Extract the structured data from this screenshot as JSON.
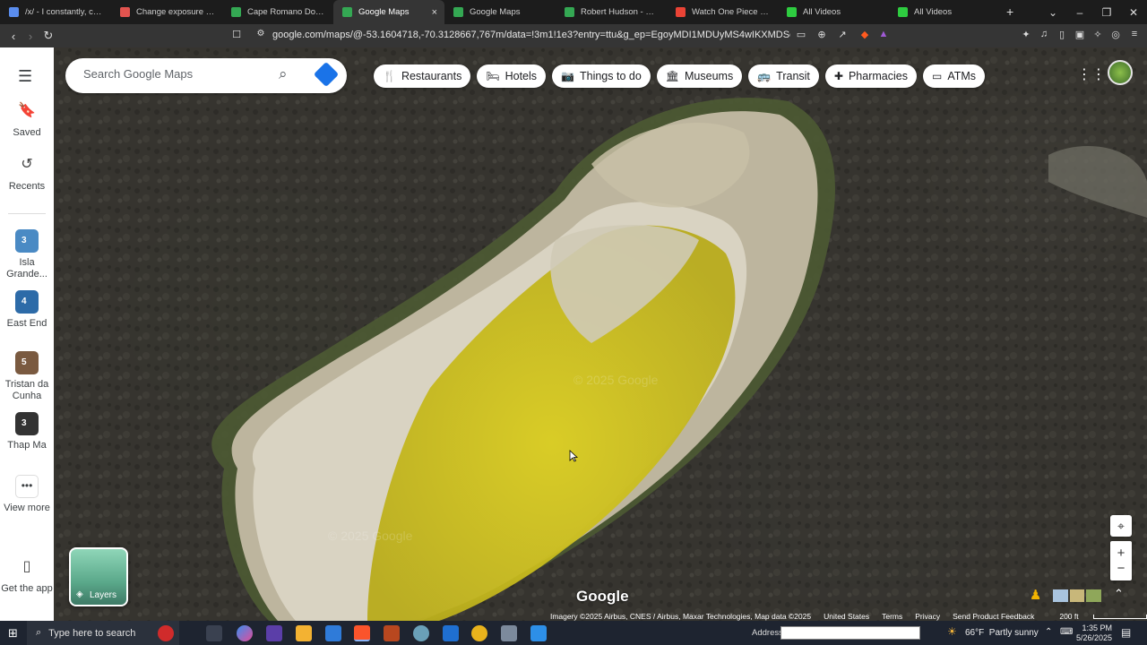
{
  "browser": {
    "tabs": [
      {
        "title": "/x/ - I constantly, constant",
        "favicon": "grid-icon",
        "color": "#5a8dee"
      },
      {
        "title": "Change exposure online",
        "favicon": "image-edit-icon",
        "color": "#e2544f"
      },
      {
        "title": "Cape Romano Dome Hou",
        "favicon": "maps-pin-icon",
        "color": "#34a853"
      },
      {
        "title": "Google Maps",
        "favicon": "maps-pin-icon",
        "color": "#34a853",
        "active": true
      },
      {
        "title": "Google Maps",
        "favicon": "maps-pin-icon",
        "color": "#34a853"
      },
      {
        "title": "Robert Hudson - Google",
        "favicon": "maps-pin-icon",
        "color": "#34a853"
      },
      {
        "title": "Watch One Piece Episode",
        "favicon": "play-icon",
        "color": "#ea4335"
      },
      {
        "title": "All Videos",
        "favicon": "play-icon",
        "color": "#2ecc40"
      },
      {
        "title": "All Videos",
        "favicon": "play-icon",
        "color": "#2ecc40"
      }
    ],
    "url": "google.com/maps/@-53.1604718,-70.3128667,767m/data=!3m1!1e3?entry=ttu&g_ep=EgoyMDI1MDUyMS4wIKXMDSoASAFQAw%3D%3D"
  },
  "rail": {
    "menu_icon": "menu-icon",
    "items": [
      {
        "label": "Saved",
        "icon": "bookmark-icon"
      },
      {
        "label": "Recents",
        "icon": "history-icon"
      }
    ],
    "recents": [
      {
        "label": "Isla Grande...",
        "badge": "3",
        "color": "#4a8ac4"
      },
      {
        "label": "East End",
        "badge": "4",
        "color": "#2d6ba8"
      },
      {
        "label": "Tristan da Cunha",
        "badge": "5",
        "color": "#7a5a40"
      },
      {
        "label": "Thap Ma",
        "badge": "3",
        "color": "#333333"
      }
    ],
    "view_more": "View more",
    "get_app": "Get the app",
    "layers": "Layers"
  },
  "search": {
    "placeholder": "Search Google Maps"
  },
  "chips": [
    {
      "label": "Restaurants",
      "icon": "fork-knife-icon"
    },
    {
      "label": "Hotels",
      "icon": "bed-icon"
    },
    {
      "label": "Things to do",
      "icon": "camera-icon"
    },
    {
      "label": "Museums",
      "icon": "museum-icon"
    },
    {
      "label": "Transit",
      "icon": "bus-icon"
    },
    {
      "label": "Pharmacies",
      "icon": "pharmacy-icon"
    },
    {
      "label": "ATMs",
      "icon": "atm-icon"
    }
  ],
  "map": {
    "logo": "Google",
    "watermark": "© 2025 Google",
    "attribution": "Imagery ©2025 Airbus, CNES / Airbus, Maxar Technologies, Map data ©2025",
    "country": "United States",
    "terms": "Terms",
    "privacy": "Privacy",
    "feedback": "Send Product Feedback",
    "scale": "200 ft",
    "lake_colors": {
      "salt": "#d9d3c2",
      "algae": "#d9cc1e",
      "shore": "#bdb59e"
    }
  },
  "taskbar": {
    "search_placeholder": "Type here to search",
    "address_label": "Address",
    "weather": "66°F  Partly sunny",
    "time": "1:35 PM",
    "date": "5/26/2025"
  }
}
